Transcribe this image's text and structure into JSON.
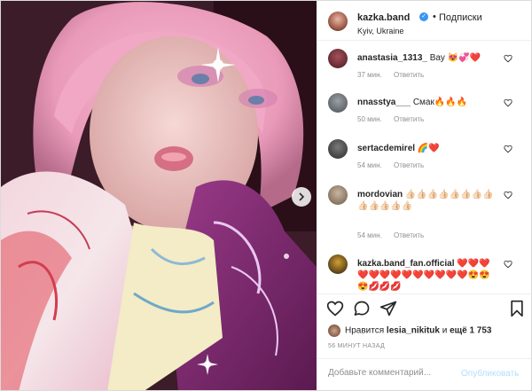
{
  "header": {
    "username": "kazka.band",
    "dot": "•",
    "follow_label": "Подписки",
    "location": "Kyiv, Ukraine"
  },
  "comments": [
    {
      "user": "anastasia_1313_",
      "text": "Вау 😻💞❤️",
      "time": "37 мин.",
      "reply": "Ответить"
    },
    {
      "user": "nnasstya___",
      "text": "Смак🔥🔥🔥",
      "time": "50 мин.",
      "reply": "Ответить"
    },
    {
      "user": "sertacdemirel",
      "text": "🌈❤️",
      "time": "54 мин.",
      "reply": "Ответить"
    },
    {
      "user": "mordovian",
      "text": "👍🏻👍🏻👍🏻👍🏻👍🏻👍🏻👍🏻👍🏻👍🏻👍🏻👍🏻👍🏻👍🏻",
      "time": "54 мин.",
      "reply": "Ответить"
    },
    {
      "user": "kazka.band_fan.official",
      "text": "❤️❤️❤️❤️❤️❤️❤️❤️❤️❤️❤️❤️❤️😍😍😍💋💋💋",
      "time": "",
      "reply": ""
    }
  ],
  "likes": {
    "prefix": "Нравится",
    "user": "lesia_nikituk",
    "middle": "и",
    "count": "ещё 1 753"
  },
  "time_ago": "56 МИНУТ НАЗАД",
  "add_comment": {
    "placeholder": "Добавьте комментарий...",
    "publish_label": "Опубликовать"
  },
  "colors": {
    "verified": "#3897f0",
    "publish": "#b2dffc",
    "muted": "#8e8e8e",
    "text": "#262626"
  },
  "icons": [
    "next-arrow-icon",
    "verified-badge-icon",
    "heart-icon",
    "comment-icon",
    "share-icon",
    "bookmark-icon"
  ]
}
